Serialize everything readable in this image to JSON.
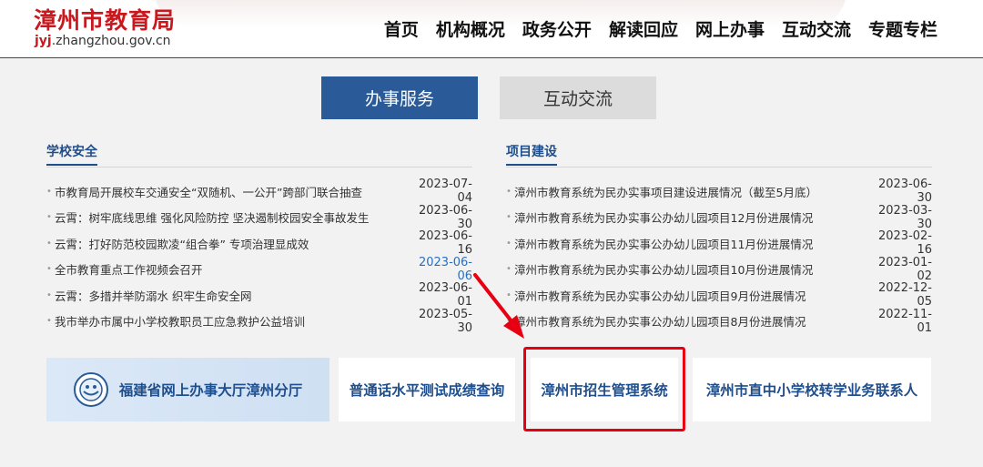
{
  "header": {
    "logo_title": "漳州市教育局",
    "logo_url_highlight": "jyj",
    "logo_url_rest": ".zhangzhou.gov.cn",
    "nav": [
      "首页",
      "机构概况",
      "政务公开",
      "解读回应",
      "网上办事",
      "互动交流",
      "专题专栏"
    ]
  },
  "tabs": {
    "active": "办事服务",
    "inactive": "互动交流"
  },
  "left_column": {
    "title": "学校安全",
    "items": [
      {
        "title": "市教育局开展校车交通安全“双随机、一公开”跨部门联合抽查",
        "date": "2023-07-04"
      },
      {
        "title": "云霄：树牢底线思维 强化风险防控 坚决遏制校园安全事故发生",
        "date": "2023-06-30"
      },
      {
        "title": "云霄：打好防范校园欺凌“组合拳” 专项治理显成效",
        "date": "2023-06-16"
      },
      {
        "title": "全市教育重点工作视频会召开",
        "date": "2023-06-06"
      },
      {
        "title": "云霄：多措并举防溺水 织牢生命安全网",
        "date": "2023-06-01"
      },
      {
        "title": "我市举办市属中小学校教职员工应急救护公益培训",
        "date": "2023-05-30"
      }
    ]
  },
  "right_column": {
    "title": "项目建设",
    "items": [
      {
        "title": "漳州市教育系统为民办实事项目建设进展情况（截至5月底）",
        "date": "2023-06-30"
      },
      {
        "title": "漳州市教育系统为民办实事公办幼儿园项目12月份进展情况",
        "date": "2023-03-30"
      },
      {
        "title": "漳州市教育系统为民办实事公办幼儿园项目11月份进展情况",
        "date": "2023-02-16"
      },
      {
        "title": "漳州市教育系统为民办实事公办幼儿园项目10月份进展情况",
        "date": "2023-01-02"
      },
      {
        "title": "漳州市教育系统为民办实事公办幼儿园项目9月份进展情况",
        "date": "2022-12-05"
      },
      {
        "title": "漳州市教育系统为民办实事公办幼儿园项目8月份进展情况",
        "date": "2022-11-01"
      }
    ]
  },
  "links": {
    "card1": "福建省网上办事大厅漳州分厅",
    "card2": "普通话水平测试成绩查询",
    "card3": "漳州市招生管理系统",
    "card4": "漳州市直中小学校转学业务联系人"
  },
  "colors": {
    "brand_red": "#c8191e",
    "brand_blue": "#1f4e8c",
    "highlight_red": "#e60012"
  }
}
